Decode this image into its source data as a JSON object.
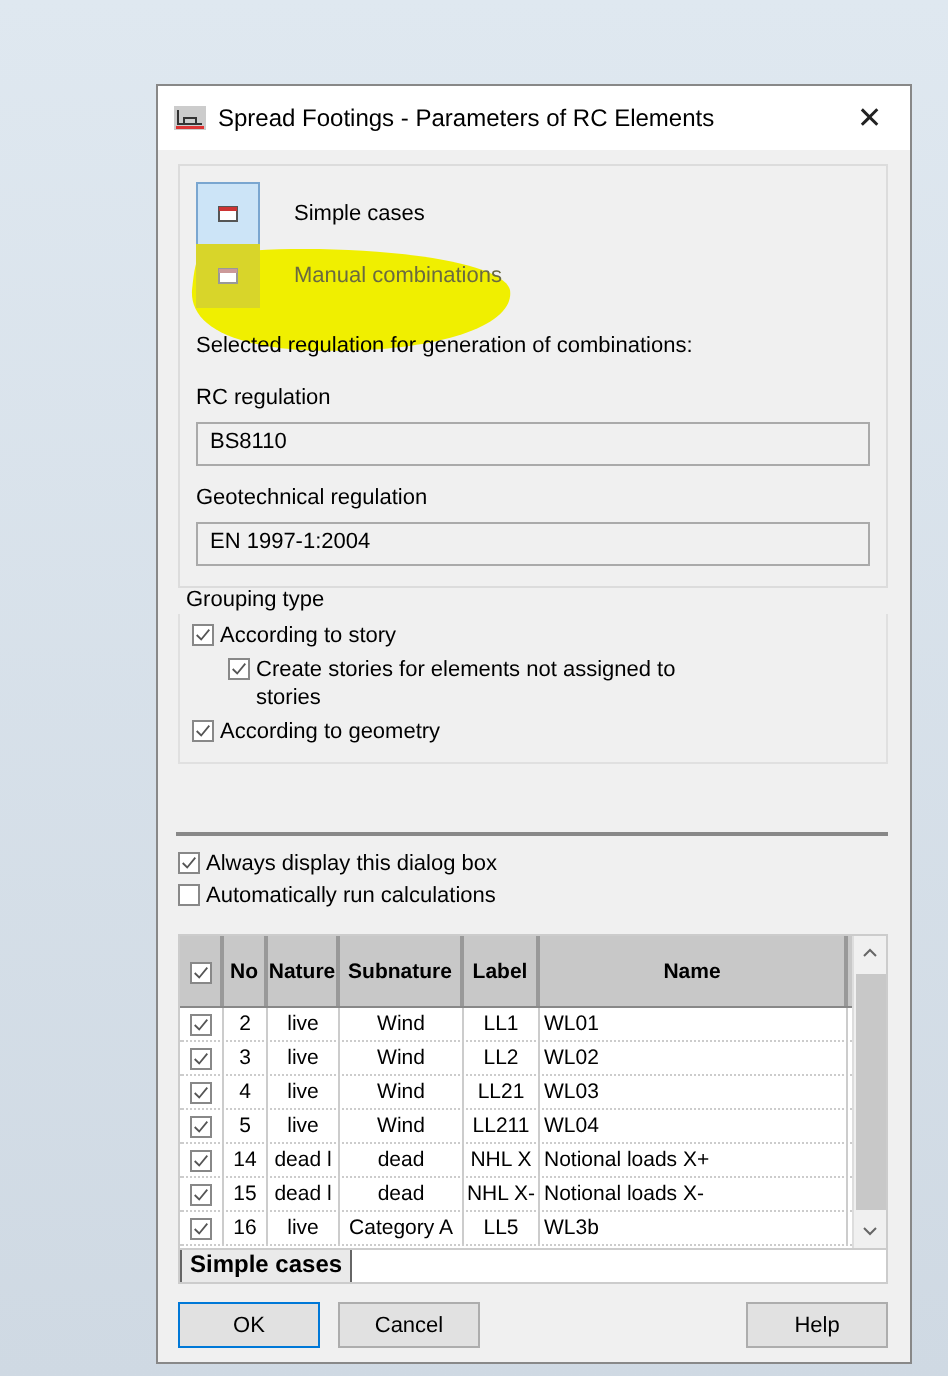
{
  "window": {
    "title": "Spread Footings - Parameters of RC Elements",
    "close": "✕"
  },
  "modes": [
    {
      "label": "Simple cases",
      "selected": true,
      "disabled": false
    },
    {
      "label": "Manual combinations",
      "selected": false,
      "disabled": true
    }
  ],
  "regulation_heading": "Selected regulation for generation of combinations:",
  "fields": [
    {
      "label": "RC regulation",
      "value": "BS8110"
    },
    {
      "label": "Geotechnical regulation",
      "value": "EN 1997-1:2004"
    }
  ],
  "grouping": {
    "title": "Grouping type",
    "options": [
      {
        "label": "According to story",
        "checked": true,
        "children": [
          {
            "label": "Create stories for elements not assigned to stories",
            "checked": true
          }
        ]
      },
      {
        "label": "According to geometry",
        "checked": true
      }
    ]
  },
  "options": [
    {
      "label": "Always display this dialog box",
      "checked": true
    },
    {
      "label": "Automatically run calculations",
      "checked": false
    }
  ],
  "table": {
    "all_checked": true,
    "columns": [
      "No",
      "Nature",
      "Subnature",
      "Label",
      "Name"
    ],
    "rows": [
      {
        "checked": true,
        "cells": [
          "2",
          "live",
          "Wind",
          "LL1",
          "WL01"
        ]
      },
      {
        "checked": true,
        "cells": [
          "3",
          "live",
          "Wind",
          "LL2",
          "WL02"
        ]
      },
      {
        "checked": true,
        "cells": [
          "4",
          "live",
          "Wind",
          "LL21",
          "WL03"
        ]
      },
      {
        "checked": true,
        "cells": [
          "5",
          "live",
          "Wind",
          "LL211",
          "WL04"
        ]
      },
      {
        "checked": true,
        "cells": [
          "14",
          "dead l",
          "dead",
          "NHL X",
          "Notional loads X+"
        ]
      },
      {
        "checked": true,
        "cells": [
          "15",
          "dead l",
          "dead",
          "NHL X-",
          "Notional loads X-"
        ]
      },
      {
        "checked": true,
        "cells": [
          "16",
          "live",
          "Category A",
          "LL5",
          "WL3b"
        ]
      }
    ]
  },
  "sheet_tabs": [
    {
      "label": "Simple cases",
      "selected": true
    }
  ],
  "buttons": [
    {
      "label": "OK",
      "kind": "default"
    },
    {
      "label": "Cancel",
      "kind": "normal"
    },
    {
      "label": "Help",
      "kind": "normal"
    }
  ]
}
